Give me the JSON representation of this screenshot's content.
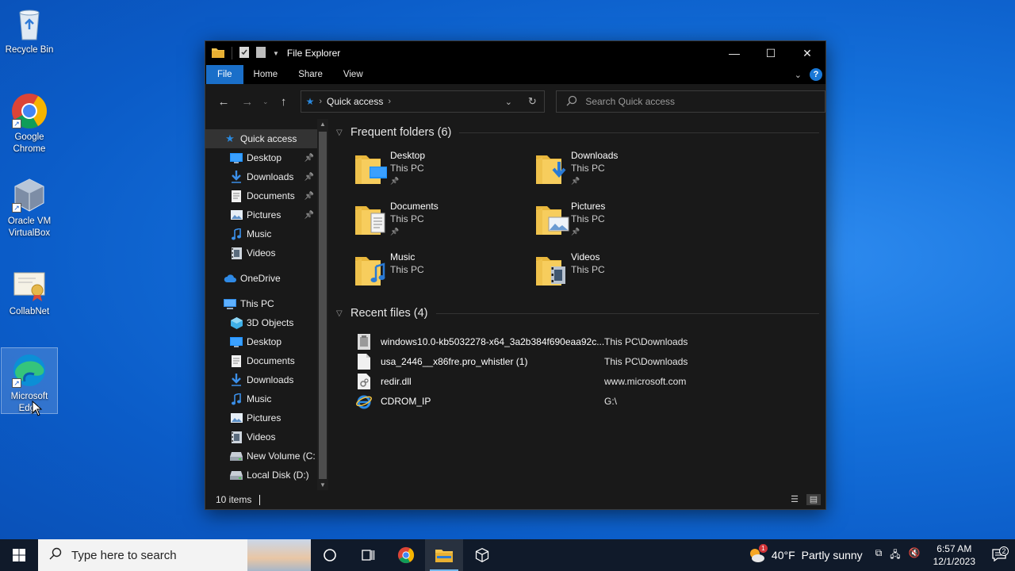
{
  "desktop": {
    "icons": [
      {
        "label": "Recycle Bin",
        "icon": "recycle-bin-icon"
      },
      {
        "label": "Google Chrome",
        "icon": "chrome-icon"
      },
      {
        "label": "Oracle VM VirtualBox",
        "icon": "virtualbox-icon"
      },
      {
        "label": "CollabNet",
        "icon": "certificate-icon"
      },
      {
        "label": "Microsoft Edge",
        "icon": "edge-icon"
      }
    ]
  },
  "window": {
    "title": "File Explorer",
    "ribbon_tabs": [
      "File",
      "Home",
      "Share",
      "View"
    ],
    "address": {
      "segment": "Quick access"
    },
    "search": {
      "placeholder": "Search Quick access"
    },
    "accent_color": "#1a6fc9"
  },
  "nav_pane": {
    "items": [
      {
        "label": "Quick access",
        "icon": "star-icon",
        "level": 0,
        "active": true
      },
      {
        "label": "Desktop",
        "icon": "desktop-icon",
        "level": 1,
        "pinned": true
      },
      {
        "label": "Downloads",
        "icon": "download-icon",
        "level": 1,
        "pinned": true
      },
      {
        "label": "Documents",
        "icon": "document-icon",
        "level": 1,
        "pinned": true
      },
      {
        "label": "Pictures",
        "icon": "picture-icon",
        "level": 1,
        "pinned": true
      },
      {
        "label": "Music",
        "icon": "music-icon",
        "level": 1
      },
      {
        "label": "Videos",
        "icon": "video-icon",
        "level": 1
      },
      {
        "label": "OneDrive",
        "icon": "cloud-icon",
        "level": 0
      },
      {
        "label": "This PC",
        "icon": "computer-icon",
        "level": 0
      },
      {
        "label": "3D Objects",
        "icon": "cube-icon",
        "level": 1
      },
      {
        "label": "Desktop",
        "icon": "desktop-icon",
        "level": 1
      },
      {
        "label": "Documents",
        "icon": "document-icon",
        "level": 1
      },
      {
        "label": "Downloads",
        "icon": "download-icon",
        "level": 1
      },
      {
        "label": "Music",
        "icon": "music-icon",
        "level": 1
      },
      {
        "label": "Pictures",
        "icon": "picture-icon",
        "level": 1
      },
      {
        "label": "Videos",
        "icon": "video-icon",
        "level": 1
      },
      {
        "label": "New Volume (C:",
        "icon": "drive-icon",
        "level": 1
      },
      {
        "label": "Local Disk (D:)",
        "icon": "drive-icon",
        "level": 1
      }
    ]
  },
  "main": {
    "frequent_header": "Frequent folders (6)",
    "folders": [
      {
        "name": "Desktop",
        "location": "This PC",
        "pinned": true,
        "icon": "desktop-folder-icon"
      },
      {
        "name": "Downloads",
        "location": "This PC",
        "pinned": true,
        "icon": "downloads-folder-icon"
      },
      {
        "name": "Documents",
        "location": "This PC",
        "pinned": true,
        "icon": "documents-folder-icon"
      },
      {
        "name": "Pictures",
        "location": "This PC",
        "pinned": true,
        "icon": "pictures-folder-icon"
      },
      {
        "name": "Music",
        "location": "This PC",
        "pinned": false,
        "icon": "music-folder-icon"
      },
      {
        "name": "Videos",
        "location": "This PC",
        "pinned": false,
        "icon": "videos-folder-icon"
      }
    ],
    "recent_header": "Recent files (4)",
    "recent_files": [
      {
        "name": "windows10.0-kb5032278-x64_3a2b384f690eaa92c...",
        "location": "This PC\\Downloads",
        "icon": "package-file-icon"
      },
      {
        "name": "usa_2446__x86fre.pro_whistler (1)",
        "location": "This PC\\Downloads",
        "icon": "generic-file-icon"
      },
      {
        "name": "redir.dll",
        "location": "www.microsoft.com",
        "icon": "dll-file-icon"
      },
      {
        "name": "CDROM_IP",
        "location": "G:\\",
        "icon": "internet-explorer-icon"
      }
    ]
  },
  "status": {
    "item_count": "10 items"
  },
  "taskbar": {
    "search_placeholder": "Type here to search",
    "apps": [
      "cortana-icon",
      "task-view-icon",
      "chrome-icon",
      "file-explorer-icon",
      "virtualbox-icon"
    ],
    "weather": {
      "temp": "40°F",
      "condition": "Partly sunny",
      "badge": "1"
    },
    "clock": {
      "time": "6:57 AM",
      "date": "12/1/2023"
    },
    "notification_count": "2"
  }
}
